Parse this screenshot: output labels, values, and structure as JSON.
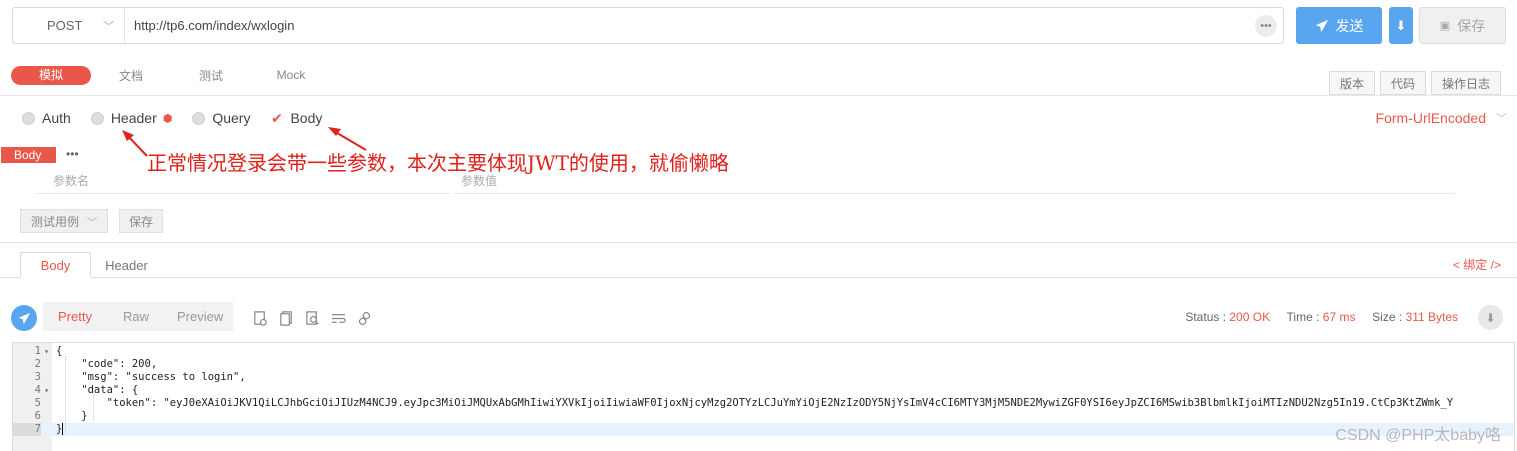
{
  "request": {
    "method": "POST",
    "url": "http://tp6.com/index/wxlogin",
    "more": "•••",
    "send_label": "发送",
    "save_label": "保存"
  },
  "top_tabs": [
    "模拟",
    "文档",
    "测试",
    "Mock"
  ],
  "right_tabs": [
    "版本",
    "代码",
    "操作日志"
  ],
  "param_types": {
    "auth": "Auth",
    "header": "Header",
    "query": "Query",
    "body": "Body",
    "selected": "Body"
  },
  "encoding": "Form-UrlEncoded",
  "annotation": "正常情况登录会带一些参数，本次主要体现JWT的使用，就偷懒略",
  "body_params": {
    "tag": "Body",
    "more": "•••",
    "name_placeholder": "参数名",
    "value_placeholder": "参数值",
    "test_case_label": "测试用例",
    "save_label": "保存"
  },
  "response": {
    "tabs": [
      "Body",
      "Header"
    ],
    "bind_link": "< 绑定 />",
    "view_tabs": [
      "Pretty",
      "Raw",
      "Preview"
    ],
    "status_label": "Status :",
    "status_value": "200 OK",
    "time_label": "Time :",
    "time_value": "67 ms",
    "size_label": "Size :",
    "size_value": "311 Bytes"
  },
  "code_lines": [
    {
      "n": "1",
      "fold": "▾",
      "text": "{"
    },
    {
      "n": "2",
      "fold": "",
      "text": "    \"code\": 200,"
    },
    {
      "n": "3",
      "fold": "",
      "text": "    \"msg\": \"success to login\","
    },
    {
      "n": "4",
      "fold": "▾",
      "text": "    \"data\": {"
    },
    {
      "n": "5",
      "fold": "",
      "text": "        \"token\": \"eyJ0eXAiOiJKV1QiLCJhbGciOiJIUzM4NCJ9.eyJpc3MiOiJMQUxAbGMhIiwiYXVkIjoiIiwiaWF0IjoxNjcyMzg2OTYzLCJuYmYiOjE2NzIzODY5NjYsImV4cCI6MTY3MjM5NDE2MywiZGF0YSI6eyJpZCI6MSwib3BlbmlkIjoiMTIzNDU2Nzg5In19.CtCp3KtZWmk_Y"
    },
    {
      "n": "6",
      "fold": "",
      "text": "    }"
    },
    {
      "n": "7",
      "fold": "",
      "text": "}"
    }
  ],
  "watermark": "CSDN @PHP太baby咯"
}
